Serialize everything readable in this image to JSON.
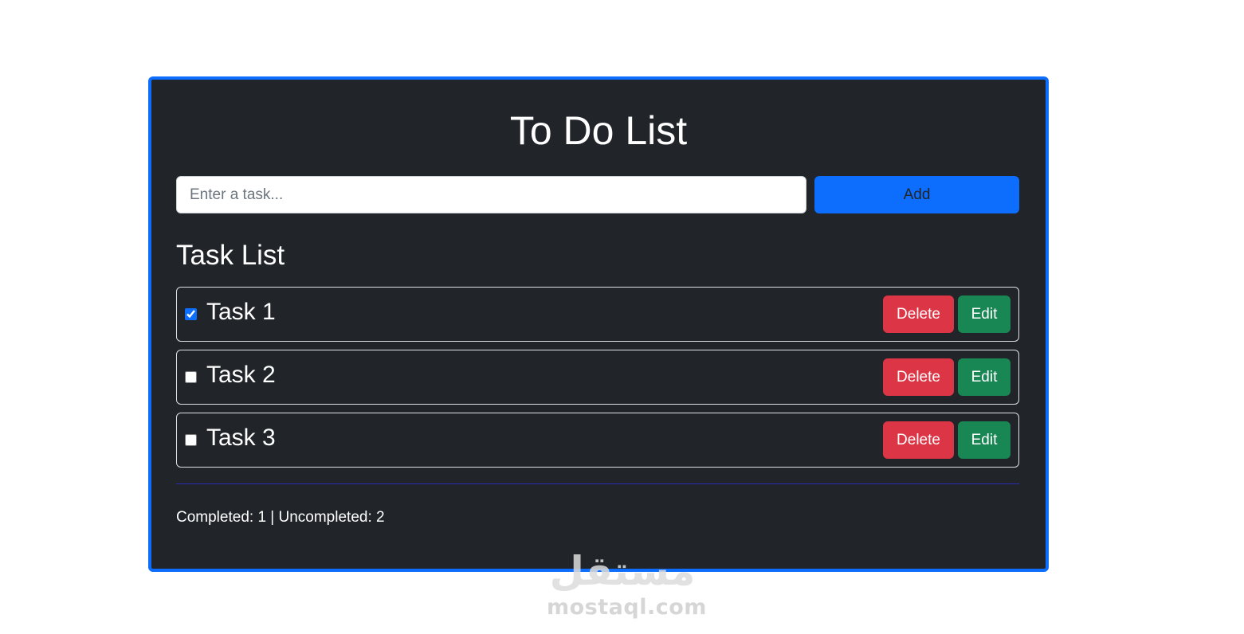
{
  "app": {
    "title": "To Do List"
  },
  "input": {
    "placeholder": "Enter a task...",
    "value": ""
  },
  "add_button": {
    "label": "Add"
  },
  "task_list": {
    "heading": "Task List",
    "tasks": [
      {
        "name": "Task 1",
        "completed": true,
        "delete_label": "Delete",
        "edit_label": "Edit"
      },
      {
        "name": "Task 2",
        "completed": false,
        "delete_label": "Delete",
        "edit_label": "Edit"
      },
      {
        "name": "Task 3",
        "completed": false,
        "delete_label": "Delete",
        "edit_label": "Edit"
      }
    ]
  },
  "stats": {
    "text": "Completed: 1 | Uncompleted: 2"
  },
  "watermark": {
    "arabic": "مستقل",
    "latin": "mostaql.com"
  },
  "colors": {
    "card_background": "#212529",
    "card_border": "#0d6efd",
    "primary": "#0d6efd",
    "danger": "#dc3545",
    "success": "#198754"
  }
}
